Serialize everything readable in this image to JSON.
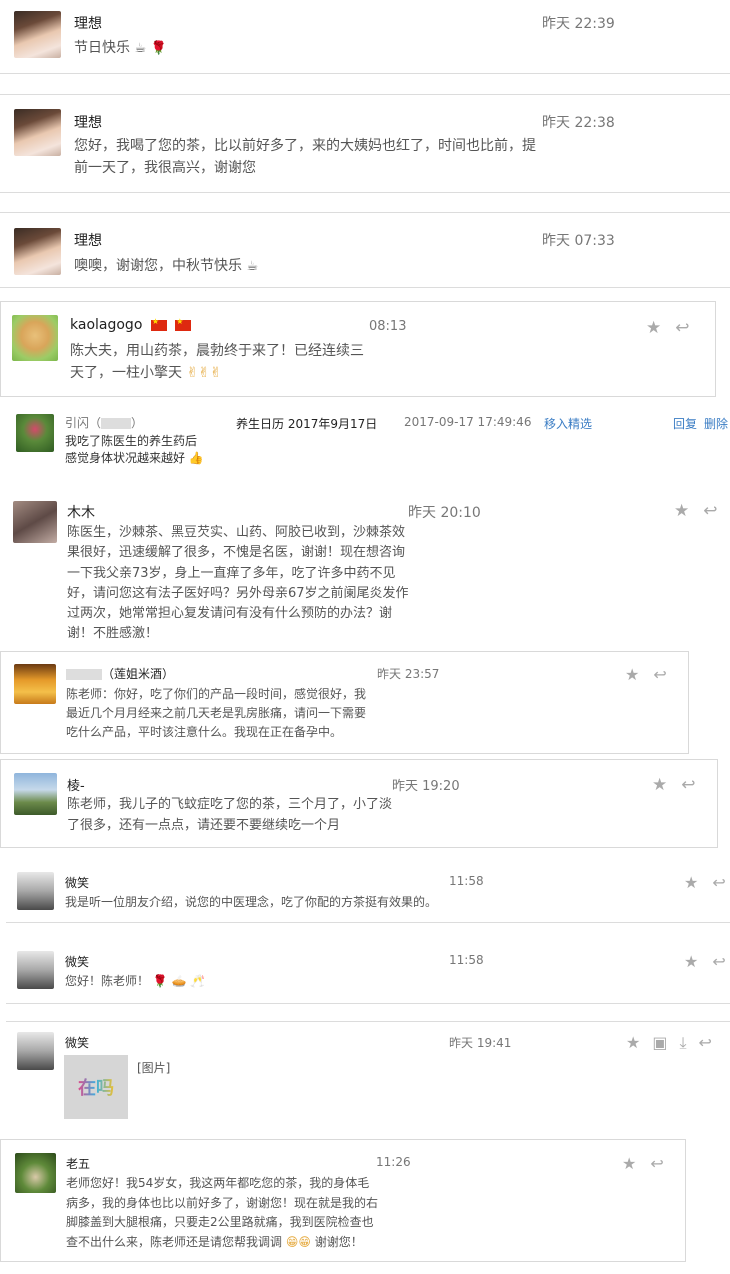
{
  "items": [
    {
      "name": "理想",
      "time": "昨天 22:39",
      "text": "节日快乐"
    },
    {
      "name": "理想",
      "time": "昨天 22:38",
      "text": "您好，我喝了您的茶，比以前好多了，来的大姨妈也红了，时间也比前，提前一天了，我很高兴，谢谢您"
    },
    {
      "name": "理想",
      "time": "昨天 07:33",
      "text": "噢噢，谢谢您，中秋节快乐"
    },
    {
      "name": "kaolagogo",
      "time": "08:13",
      "text": "陈大夫，用山药茶，晨勃终于来了！已经连续三天了，一柱小擎天"
    },
    {
      "name": "引闪（",
      "name_tail": "）",
      "title": "养生日历 2017年9月17日",
      "time": "2017-09-17 17:49:46",
      "action_select": "移入精选",
      "action_reply": "回复",
      "action_delete": "删除",
      "text": "我吃了陈医生的养生药后感觉身体状况越来越好"
    },
    {
      "name": "木木",
      "time": "昨天 20:10",
      "text": "陈医生，沙棘茶、黑豆芡实、山药、阿胶已收到，沙棘茶效果很好，迅速缓解了很多，不愧是名医，谢谢！现在想咨询一下我父亲73岁，身上一直痒了多年，吃了许多中药不见好，请问您这有法子医好吗？另外母亲67岁之前阑尾炎发作过两次，她常常担心复发请问有没有什么预防的办法？谢谢！不胜感激！"
    },
    {
      "name": "（莲姐米酒）",
      "time": "昨天 23:57",
      "text": "陈老师：你好，吃了你们的产品一段时间，感觉很好，我最近几个月月经来之前几天老是乳房胀痛，请问一下需要吃什么产品，平时该注意什么。我现在正在备孕中。"
    },
    {
      "name": "棱-",
      "time": "昨天 19:20",
      "text": "陈老师，我儿子的飞蚊症吃了您的茶，三个月了，小了淡了很多，还有一点点，请还要不要继续吃一个月"
    },
    {
      "name": "微笑",
      "time": "11:58",
      "text": "我是听一位朋友介绍，说您的中医理念，吃了你配的方茶挺有效果的。"
    },
    {
      "name": "微笑",
      "time": "11:58",
      "text": "您好！陈老师！"
    },
    {
      "name": "微笑",
      "time": "昨天 19:41",
      "text": "[图片]",
      "image_text": "在吗"
    },
    {
      "name": "老五",
      "time": "11:26",
      "text": "老师您好！我54岁女，我这两年都吃您的茶，我的身体毛病多，我的身体也比以前好多了，谢谢您！现在就是我的右脚膝盖到大腿根痛，只要走2公里路就痛，我到医院检查也查不出什么来，陈老师还是请您帮我调调",
      "text_tail": "谢谢您！"
    }
  ],
  "icons": {
    "star": "star-icon",
    "reply": "reply-icon",
    "save": "save-icon",
    "download": "download-icon"
  },
  "colors": {
    "link": "#3b7dc4",
    "card_border": "#d9d9d9",
    "divider": "#dcdcdc"
  }
}
